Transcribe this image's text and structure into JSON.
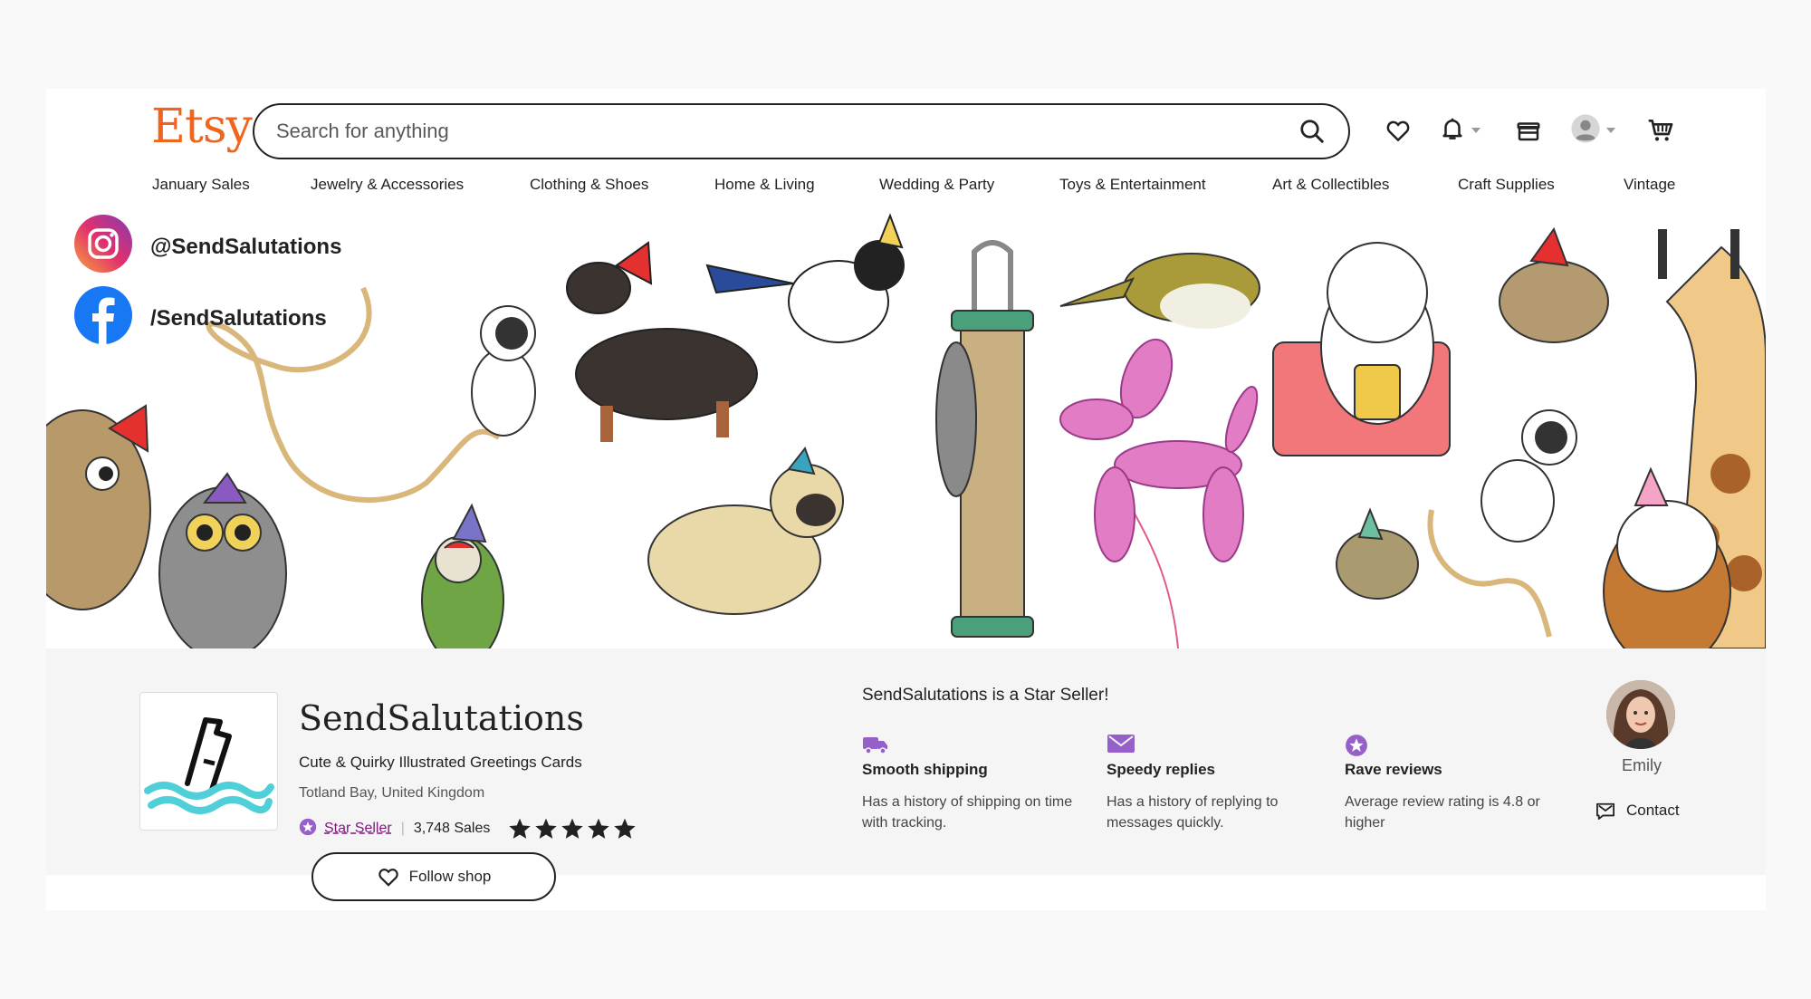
{
  "header": {
    "logo": "Etsy",
    "search_placeholder": "Search for anything",
    "icons": [
      "search-icon",
      "heart-icon",
      "bell-icon",
      "gift-icon",
      "avatar-icon",
      "cart-icon"
    ]
  },
  "categories": [
    "January Sales",
    "Jewelry & Accessories",
    "Clothing & Shoes",
    "Home & Living",
    "Wedding & Party",
    "Toys & Entertainment",
    "Art & Collectibles",
    "Craft Supplies",
    "Vintage"
  ],
  "banner": {
    "instagram_handle": "@SendSalutations",
    "facebook_handle": "/SendSalutations"
  },
  "shop": {
    "name": "SendSalutations",
    "tagline": "Cute & Quirky Illustrated Greetings Cards",
    "location": "Totland Bay, United Kingdom",
    "star_seller_label": "Star Seller",
    "sales": "3,748 Sales",
    "rating": 5,
    "follow_label": "Follow shop"
  },
  "star_seller": {
    "title": "SendSalutations is a Star Seller!",
    "features": [
      {
        "icon": "truck-icon",
        "title": "Smooth shipping",
        "desc": "Has a history of shipping on time with tracking."
      },
      {
        "icon": "message-icon",
        "title": "Speedy replies",
        "desc": "Has a history of replying to messages quickly."
      },
      {
        "icon": "star-badge-icon",
        "title": "Rave reviews",
        "desc": "Average review rating is 4.8 or higher"
      }
    ]
  },
  "owner": {
    "name": "Emily",
    "contact_label": "Contact"
  },
  "colors": {
    "brand": "#f1641e",
    "star_seller": "#7f187f",
    "feature_icon": "#9560c8"
  }
}
